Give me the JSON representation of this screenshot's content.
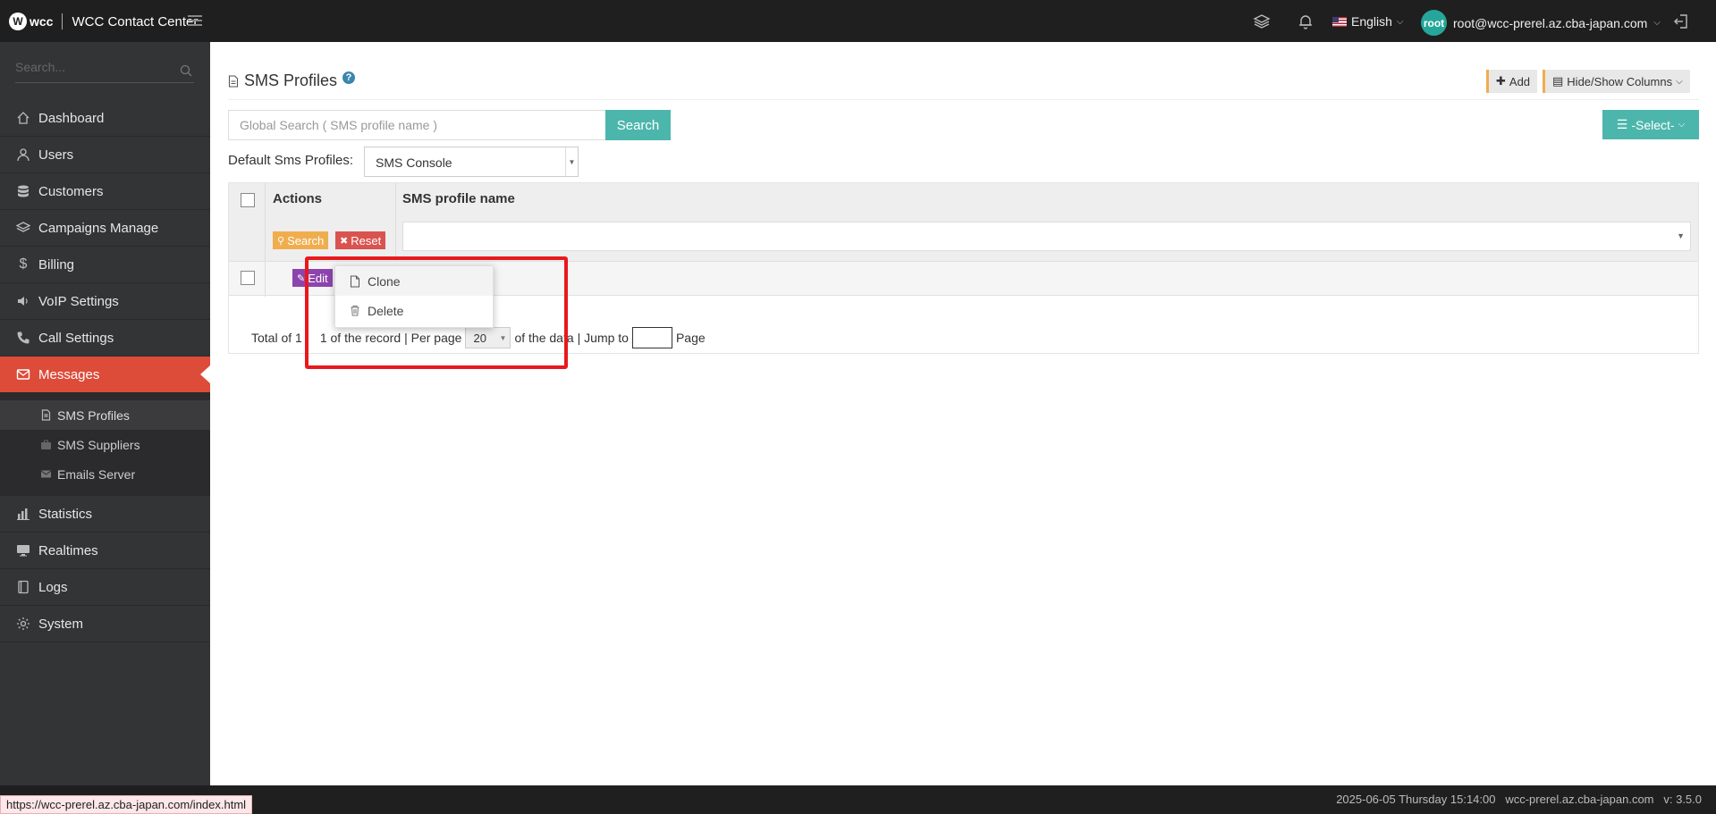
{
  "header": {
    "brand": "wcc",
    "app_title": "WCC Contact Center",
    "language": "English",
    "avatar_text": "root",
    "user_email": "root@wcc-prerel.az.cba-japan.com"
  },
  "sidebar": {
    "search_placeholder": "Search...",
    "items": [
      {
        "label": "Dashboard",
        "icon": "home-icon"
      },
      {
        "label": "Users",
        "icon": "user-icon"
      },
      {
        "label": "Customers",
        "icon": "database-icon"
      },
      {
        "label": "Campaigns Manage",
        "icon": "layers-icon"
      },
      {
        "label": "Billing",
        "icon": "dollar-icon"
      },
      {
        "label": "VoIP Settings",
        "icon": "volume-icon"
      },
      {
        "label": "Call Settings",
        "icon": "phone-icon"
      },
      {
        "label": "Messages",
        "icon": "envelope-icon"
      }
    ],
    "submenu": [
      {
        "label": "SMS Profiles",
        "icon": "document-icon"
      },
      {
        "label": "SMS Suppliers",
        "icon": "briefcase-icon"
      },
      {
        "label": "Emails Server",
        "icon": "envelope-icon"
      }
    ],
    "items_after": [
      {
        "label": "Statistics",
        "icon": "bar-chart-icon"
      },
      {
        "label": "Realtimes",
        "icon": "monitor-icon"
      },
      {
        "label": "Logs",
        "icon": "book-icon"
      },
      {
        "label": "System",
        "icon": "gear-icon"
      }
    ]
  },
  "page": {
    "title": "SMS Profiles",
    "add_label": "Add",
    "hide_show_label": "Hide/Show Columns",
    "global_search_placeholder": "Global Search ( SMS profile name )",
    "search_button": "Search",
    "select_button": "-Select-",
    "default_label": "Default Sms Profiles:",
    "default_value": "SMS Console"
  },
  "table": {
    "col_actions": "Actions",
    "col_name": "SMS profile name",
    "filter_search": "Search",
    "filter_reset": "Reset",
    "row_edit": "Edit"
  },
  "pager": {
    "total_prefix": "Total of 1",
    "record_text": "1 of the record",
    "per_page_label": "| Per page",
    "per_page_value": "20",
    "of_data": "of the data",
    "jump_label": "| Jump to",
    "page_label": "Page"
  },
  "context_menu": {
    "clone": "Clone",
    "delete": "Delete"
  },
  "footer": {
    "status_url": "https://wcc-prerel.az.cba-japan.com/index.html",
    "datetime": "2025-06-05 Thursday 15:14:00",
    "host": "wcc-prerel.az.cba-japan.com",
    "version": "v: 3.5.0"
  },
  "colors": {
    "teal": "#4db6ac",
    "active_red": "#dd4b39",
    "edit_purple": "#8e44ad",
    "search_orange": "#f0ad4e",
    "reset_red": "#d9534f",
    "highlight_red": "#e8191d"
  }
}
